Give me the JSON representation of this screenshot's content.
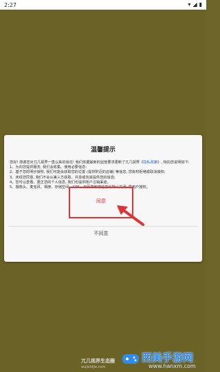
{
  "status_bar": {
    "time": "2:27",
    "icons": [
      "wifi-icon",
      "signal-icon",
      "battery-icon"
    ]
  },
  "dialog": {
    "title": "温馨提示",
    "intro_part1": "您好! 感谢您对兀几视界一直以来的信任! 我们依据最新的监管要求更新了兀几视界《",
    "link_text": "隐私政策",
    "intro_part2": "》, 特向您说明如下:",
    "items": [
      "1、为向您提供服务, 我们会收集、使用必要信息;",
      "2、基于您的明示授权, 我们可能会获取您的位置 (提供附近的店铺) 等信息, 您有权拒绝或取消授权;",
      "3、未经您同意, 我们不会从第三方获取、共享或向其提供您的信息;",
      "4、您可以查看、更正您的个人信息, 我们也提供账户注销渠道。",
      "5、摄像头、麦克风、相册、存储空间、GPS、日历等敏感信息均默认关闭, 需用户授权。"
    ],
    "agree_label": "同意",
    "decline_label": "不同意"
  },
  "footer": {
    "title": "兀几视界生态圈",
    "subtitle": "wujishijie.com"
  },
  "watermark": {
    "title": "西美手游网",
    "url": "www.hanxm.com"
  },
  "colors": {
    "backdrop": "#6b6226",
    "accent_red": "#e03434",
    "link_blue": "#2b67c8",
    "watermark_blue": "#2d8cf0"
  }
}
